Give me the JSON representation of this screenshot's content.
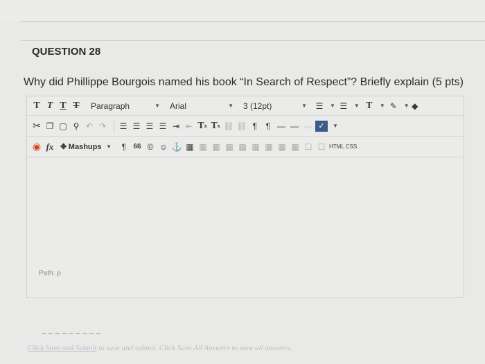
{
  "question": {
    "title": "QUESTION 28",
    "prompt": "Why did Phillippe Bourgois named his book “In Search of Respect”? Briefly explain (5 pts)"
  },
  "toolbar": {
    "row1": {
      "text_buttons": [
        "T",
        "T",
        "T",
        "T"
      ],
      "paragraph_select": "Paragraph",
      "font_select": "Arial",
      "size_select": "3 (12pt)",
      "text_color": "T"
    },
    "row2": {
      "superscript": "T",
      "superscript_mark": "x",
      "subscript": "T",
      "subscript_mark": "x",
      "pilcrow_ltr": "¶",
      "pilcrow_rtl": "¶"
    },
    "row3": {
      "formula": "fx",
      "mashups_label": "Mashups",
      "pilcrow": "¶",
      "quote": "66",
      "copyright": "©",
      "html_css": "HTML CSS"
    }
  },
  "editor": {
    "path_label": "Path:",
    "path_value": "p"
  },
  "footer": {
    "link_text": "Click Save and Submit",
    "text": "to save and submit. Click Save All Answers to save all answers."
  }
}
